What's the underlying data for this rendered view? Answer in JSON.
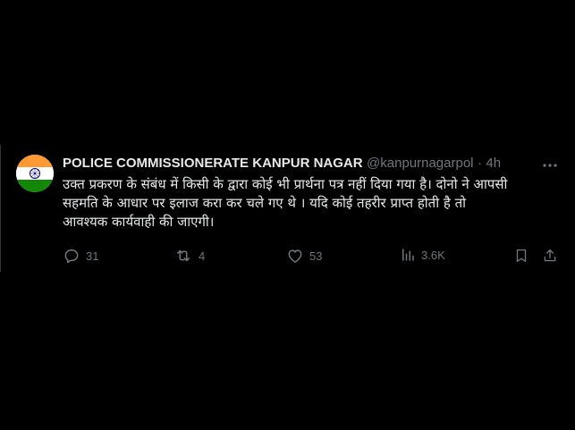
{
  "account": {
    "display_name": "POLICE COMMISSIONERATE KANPUR NAGAR",
    "handle": "@kanpurnagarpol",
    "separator": "·",
    "time": "4h"
  },
  "tweet": {
    "text": "उक्त प्रकरण के संबंध में किसी के द्वारा कोई भी प्रार्थना पत्र नहीं दिया गया है। दोनो ने आपसी\nसहमति के आधार पर इलाज करा कर चले गए थे । यदि कोई तहरीर प्राप्त होती है तो\nआवश्यक कार्यवाही की जाएगी।"
  },
  "actions": {
    "replies": "31",
    "reposts": "4",
    "likes": "53",
    "views": "3.6K"
  },
  "icons": [
    "more-icon",
    "reply-icon",
    "repost-icon",
    "like-icon",
    "views-icon",
    "bookmark-icon",
    "share-icon"
  ],
  "colors": {
    "background": "#000000",
    "text": "#e7e9ea",
    "muted": "#71767b",
    "flag_saffron": "#ff9933",
    "flag_green": "#138808",
    "chakra": "#000080"
  }
}
